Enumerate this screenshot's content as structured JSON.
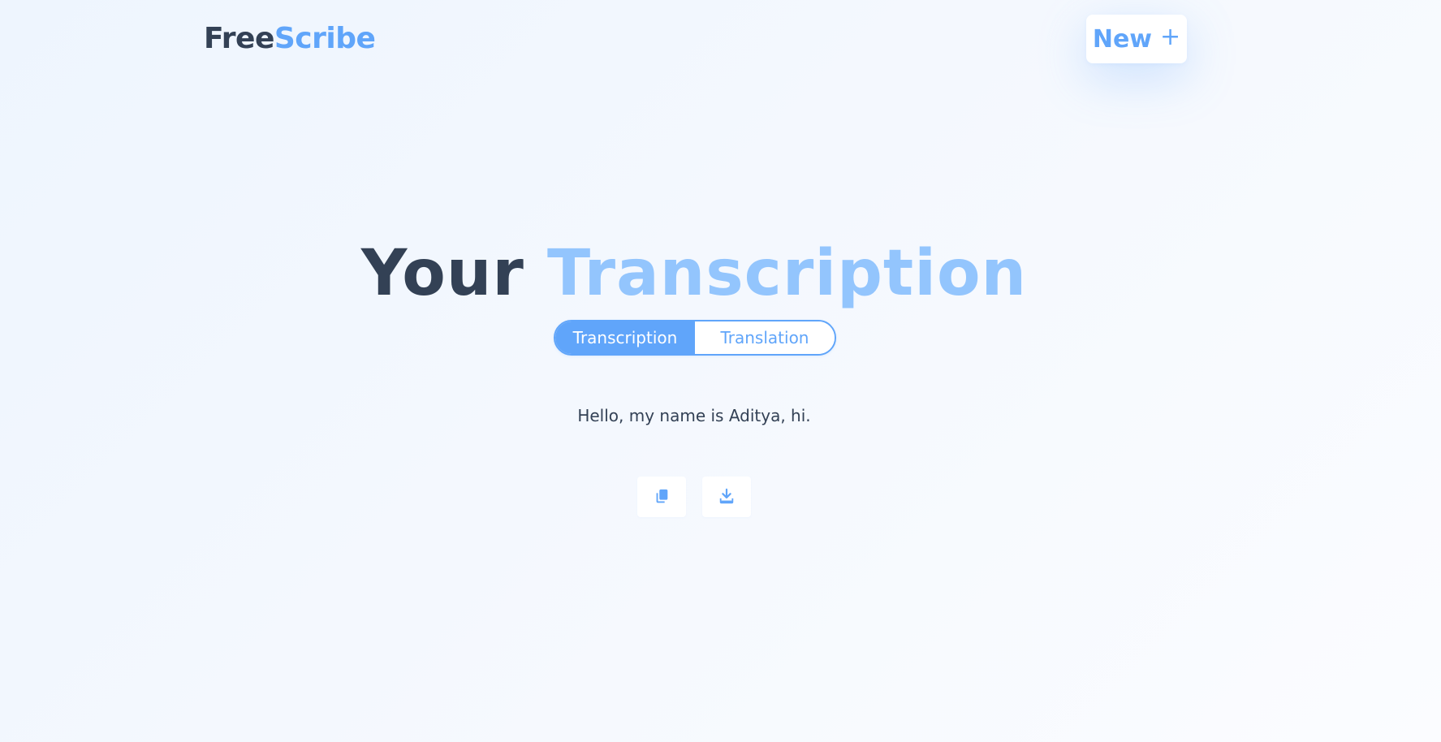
{
  "header": {
    "logo_part1": "Free",
    "logo_part2": "Scribe",
    "new_button_label": "New",
    "new_button_icon": "+"
  },
  "hero": {
    "title_part1": "Your",
    "title_part2": "Transcription"
  },
  "tabs": [
    {
      "label": "Transcription",
      "active": true
    },
    {
      "label": "Translation",
      "active": false
    }
  ],
  "transcript": {
    "text": "Hello, my name is Aditya, hi."
  },
  "actions": [
    {
      "icon": "copy-icon"
    },
    {
      "icon": "download-icon"
    }
  ],
  "colors": {
    "accent": "#60a5fa",
    "accent_light": "#93c5fd",
    "dark_text": "#334155",
    "background": "#f4f8fe"
  }
}
